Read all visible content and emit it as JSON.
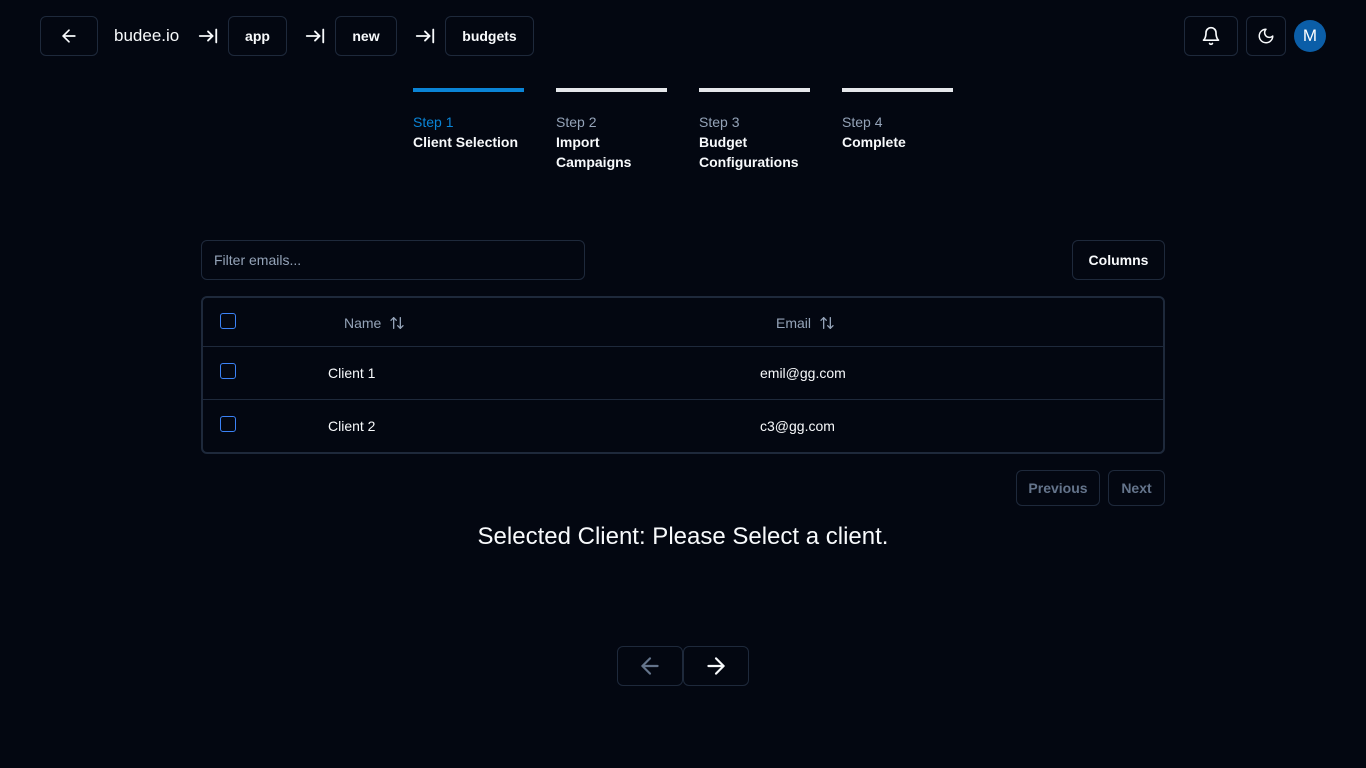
{
  "header": {
    "brand": "budee.io",
    "breadcrumbs": [
      "app",
      "new",
      "budgets"
    ],
    "avatar_initial": "M"
  },
  "steps": [
    {
      "number": "Step 1",
      "title": "Client Selection",
      "active": true
    },
    {
      "number": "Step 2",
      "title": "Import Campaigns",
      "active": false
    },
    {
      "number": "Step 3",
      "title": "Budget Configurations",
      "active": false
    },
    {
      "number": "Step 4",
      "title": "Complete",
      "active": false
    }
  ],
  "filter": {
    "placeholder": "Filter emails...",
    "value": ""
  },
  "columns_label": "Columns",
  "table": {
    "headers": {
      "name": "Name",
      "email": "Email"
    },
    "rows": [
      {
        "name": "Client 1",
        "email": "emil@gg.com"
      },
      {
        "name": "Client 2",
        "email": "c3@gg.com"
      }
    ]
  },
  "pagination": {
    "previous": "Previous",
    "next": "Next"
  },
  "selected_client_text": "Selected Client: Please Select a client.",
  "colors": {
    "background": "#030711",
    "accent": "#0a84d6",
    "border": "#1e293b",
    "avatar": "#0b5ea8"
  },
  "icons": {
    "back": "arrow-left-icon",
    "crumb_separator": "arrow-right-to-line-icon",
    "bell": "bell-icon",
    "theme": "moon-icon",
    "sort": "arrow-up-down-icon",
    "nav_prev": "arrow-left-icon",
    "nav_next": "arrow-right-icon"
  }
}
